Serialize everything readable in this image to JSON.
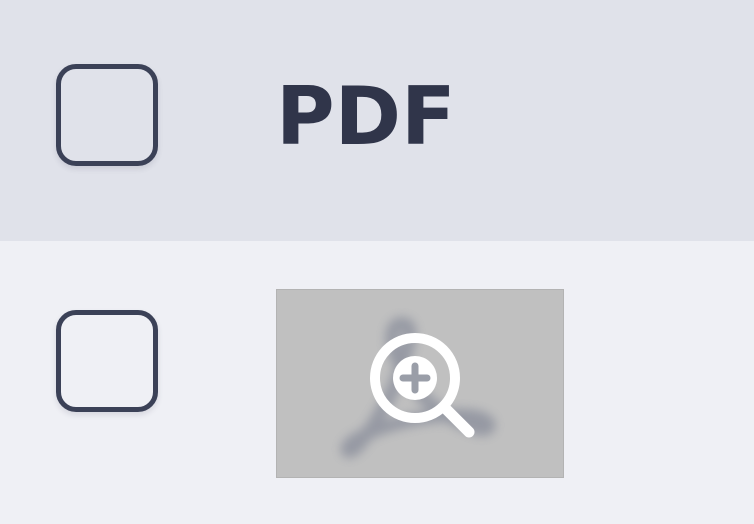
{
  "header": {
    "checkbox_checked": false,
    "column_label": "PDF"
  },
  "rows": [
    {
      "checkbox_checked": false,
      "thumbnail": {
        "file_type": "pdf",
        "background_icon": "acrobat-logo-icon",
        "overlay_icon": "zoom-in-icon"
      }
    }
  ],
  "colors": {
    "header_bg": "#e0e2ea",
    "row_bg": "#eff0f5",
    "checkbox_border": "#3b4157",
    "header_text": "#30354a",
    "thumb_bg": "#c0c0c0"
  }
}
